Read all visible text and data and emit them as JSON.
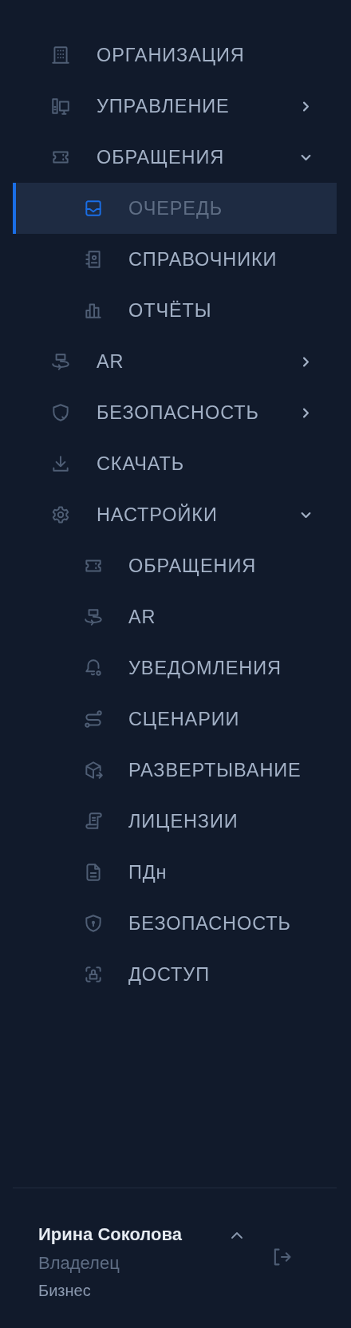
{
  "nav": [
    {
      "label": "ОРГАНИЗАЦИЯ"
    },
    {
      "label": "УПРАВЛЕНИЕ",
      "expanded": false
    },
    {
      "label": "ОБРАЩЕНИЯ",
      "expanded": true,
      "children": [
        {
          "label": "ОЧЕРЕДЬ",
          "selected": true
        },
        {
          "label": "СПРАВОЧНИКИ",
          "selected": false
        },
        {
          "label": "ОТЧЁТЫ",
          "selected": false
        }
      ]
    },
    {
      "label": "AR",
      "expanded": false
    },
    {
      "label": "БЕЗОПАСНОСТЬ",
      "expanded": false
    },
    {
      "label": "СКАЧАТЬ"
    },
    {
      "label": "НАСТРОЙКИ",
      "expanded": true,
      "children": [
        {
          "label": "ОБРАЩЕНИЯ",
          "selected": false
        },
        {
          "label": "AR",
          "selected": false
        },
        {
          "label": "УВЕДОМЛЕНИЯ",
          "selected": false
        },
        {
          "label": "СЦЕНАРИИ",
          "selected": false
        },
        {
          "label": "РАЗВЕРТЫВАНИЕ",
          "selected": false
        },
        {
          "label": "ЛИЦЕНЗИИ",
          "selected": false
        },
        {
          "label": "ПДн",
          "selected": false
        },
        {
          "label": "БЕЗОПАСНОСТЬ",
          "selected": false
        },
        {
          "label": "ДОСТУП",
          "selected": false
        }
      ]
    }
  ],
  "user": {
    "name": "Ирина Соколова",
    "role": "Владелец",
    "plan": "Бизнес"
  }
}
